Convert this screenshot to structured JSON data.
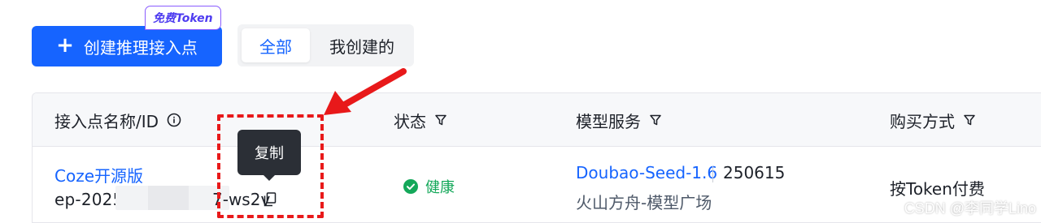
{
  "toolbar": {
    "create_label": "创建推理接入点",
    "free_badge": "免费Token",
    "tabs": [
      {
        "label": "全部",
        "active": true
      },
      {
        "label": "我创建的",
        "active": false
      }
    ]
  },
  "table": {
    "columns": [
      {
        "label": "接入点名称/ID",
        "icon": "info-icon"
      },
      {
        "label": "状态",
        "icon": "filter-icon"
      },
      {
        "label": "模型服务",
        "icon": "filter-icon"
      },
      {
        "label": "购买方式",
        "icon": "filter-icon"
      }
    ],
    "rows": [
      {
        "name": "Coze开源版",
        "id_prefix": "ep-2025",
        "id_suffix": "7-ws2v",
        "status": "健康",
        "model_name": "Doubao-Seed-1.6",
        "model_version": "250615",
        "model_platform": "火山方舟-模型广场",
        "purchase": "按Token付费"
      }
    ]
  },
  "tooltip": {
    "text": "复制"
  },
  "watermark": "CSDN @李同学Lino",
  "colors": {
    "primary": "#1664ff",
    "success": "#14a85a",
    "annotation": "#e8191a",
    "badge_border": "#8a5cff"
  }
}
